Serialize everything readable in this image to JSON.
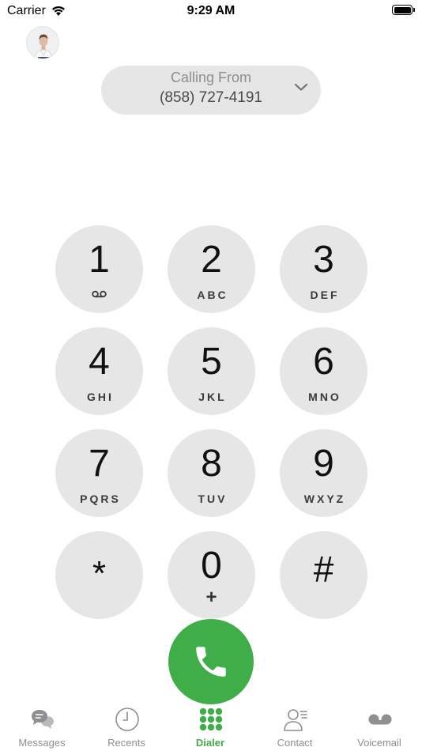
{
  "status_bar": {
    "carrier": "Carrier",
    "time": "9:29 AM"
  },
  "calling_from": {
    "label": "Calling From",
    "number": "(858) 727-4191"
  },
  "keypad": [
    {
      "digit": "1",
      "letters": ""
    },
    {
      "digit": "2",
      "letters": "ABC"
    },
    {
      "digit": "3",
      "letters": "DEF"
    },
    {
      "digit": "4",
      "letters": "GHI"
    },
    {
      "digit": "5",
      "letters": "JKL"
    },
    {
      "digit": "6",
      "letters": "MNO"
    },
    {
      "digit": "7",
      "letters": "PQRS"
    },
    {
      "digit": "8",
      "letters": "TUV"
    },
    {
      "digit": "9",
      "letters": "WXYZ"
    },
    {
      "digit": "*",
      "letters": ""
    },
    {
      "digit": "0",
      "letters": "+"
    },
    {
      "digit": "#",
      "letters": ""
    }
  ],
  "tabs": [
    {
      "label": "Messages",
      "icon": "messages-icon"
    },
    {
      "label": "Recents",
      "icon": "clock-icon"
    },
    {
      "label": "Dialer",
      "icon": "keypad-icon",
      "active": true
    },
    {
      "label": "Contact",
      "icon": "contact-icon"
    },
    {
      "label": "Voicemail",
      "icon": "voicemail-icon"
    }
  ],
  "colors": {
    "accent": "#3fae49",
    "key_background": "#e6e6e6",
    "inactive_tab": "#8e8e93"
  }
}
